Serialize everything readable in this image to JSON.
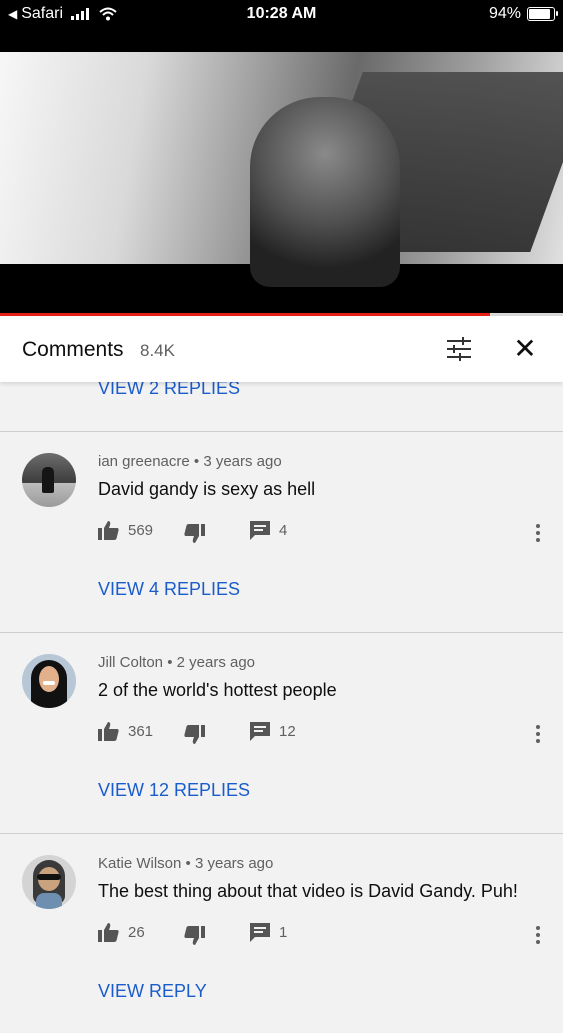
{
  "status_bar": {
    "back_label": "Safari",
    "time": "10:28 AM",
    "battery": "94%",
    "battery_level": 0.94
  },
  "video": {
    "progress": 0.87
  },
  "comments_header": {
    "title": "Comments",
    "count": "8.4K"
  },
  "top_replies_link": "VIEW 2 REPLIES",
  "comments": [
    {
      "author": "ian greenacre",
      "time": "3 years ago",
      "text": "David gandy is sexy as hell",
      "likes": "569",
      "reply_count": "4",
      "replies_link": "VIEW 4 REPLIES"
    },
    {
      "author": "Jill Colton",
      "time": "2 years ago",
      "text": "2 of the world's hottest people",
      "likes": "361",
      "reply_count": "12",
      "replies_link": "VIEW 12 REPLIES"
    },
    {
      "author": "Katie Wilson",
      "time": "3 years ago",
      "text": "The best thing about that video is David Gandy. Puh!",
      "likes": "26",
      "reply_count": "1",
      "replies_link": "VIEW REPLY"
    }
  ],
  "colors": {
    "link": "#1a5ccc",
    "progress": "#e62117",
    "background": "#f2f2f2"
  }
}
